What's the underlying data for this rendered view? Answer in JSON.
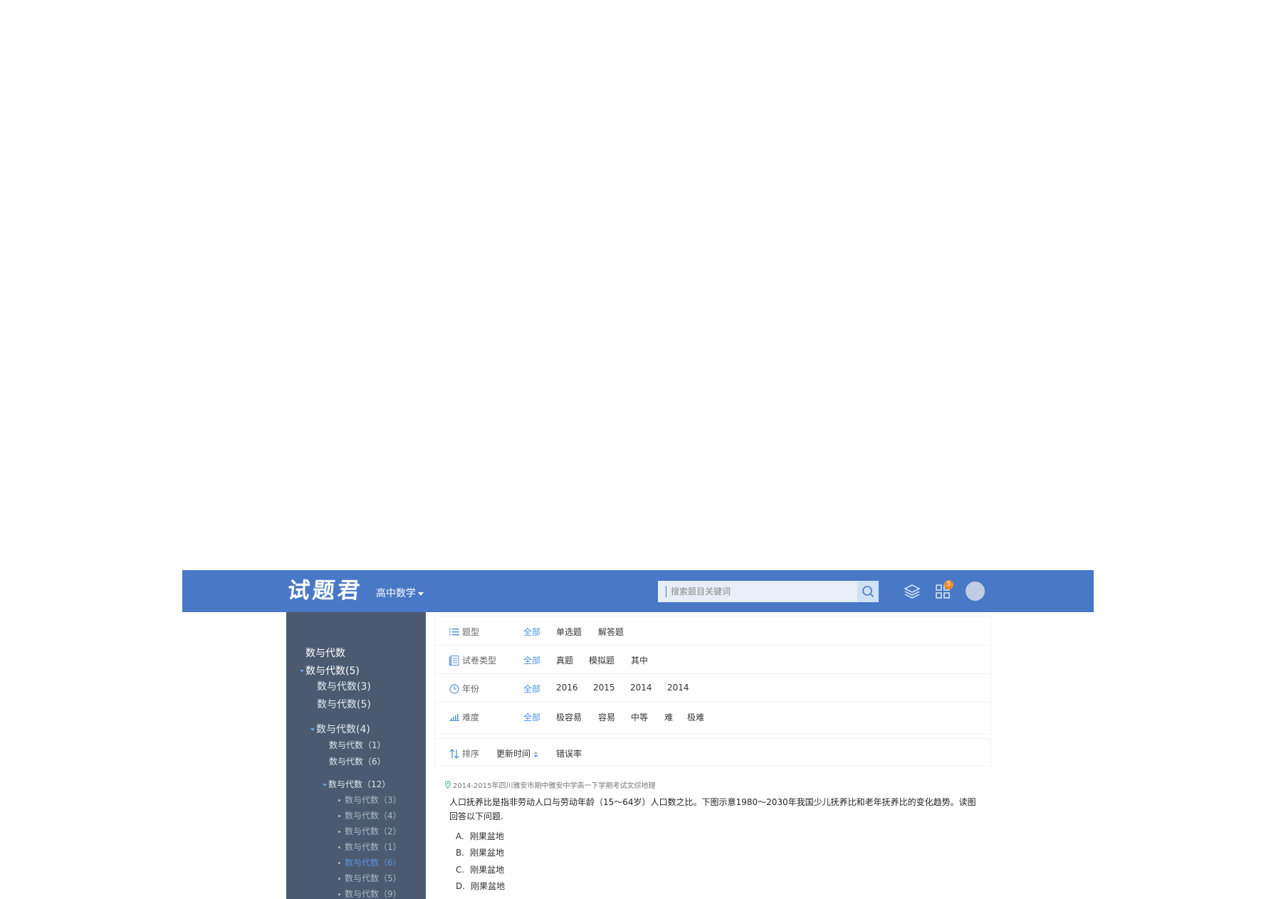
{
  "header": {
    "logo": "试题君",
    "subject": "高中数学",
    "search_placeholder": "搜索题目关键词",
    "badge_count": "5"
  },
  "sidebar": {
    "root": "数与代数",
    "items": [
      {
        "label": "数与代数(5)"
      },
      {
        "label": "数与代数(3)"
      },
      {
        "label": "数与代数(5)"
      },
      {
        "label": "数与代数(4)"
      },
      {
        "label": "数与代数（1）"
      },
      {
        "label": "数与代数（6）"
      },
      {
        "label": "数与代数（12）"
      },
      {
        "label": "数与代数（3）"
      },
      {
        "label": "数与代数（4）"
      },
      {
        "label": "数与代数（2）"
      },
      {
        "label": "数与代数（1）"
      },
      {
        "label": "数与代数（6）"
      },
      {
        "label": "数与代数（5）"
      },
      {
        "label": "数与代数（9）"
      }
    ]
  },
  "filters": {
    "type": {
      "label": "题型",
      "options": [
        "全部",
        "单选题",
        "解答题"
      ]
    },
    "paper": {
      "label": "试卷类型",
      "options": [
        "全部",
        "真题",
        "模拟题",
        "其中"
      ]
    },
    "year": {
      "label": "年份",
      "options": [
        "全部",
        "2016",
        "2015",
        "2014",
        "2014"
      ]
    },
    "difficulty": {
      "label": "难度",
      "options": [
        "全部",
        "极容易",
        "容易",
        "中等",
        "难",
        "极难"
      ]
    }
  },
  "sort": {
    "label": "排序",
    "options": [
      "更新时间",
      "错误率"
    ]
  },
  "question": {
    "source": "2014-2015年四川雅安市期中雅安中学高一下学期考试文综地理",
    "stem": "人口抚养比是指非劳动人口与劳动年龄（15～64岁）人口数之比。下图示意1980～2030年我国少儿抚养比和老年抚养比的变化趋势。读图回答以下问题.",
    "options": [
      {
        "letter": "A.",
        "text": "刚果盆地"
      },
      {
        "letter": "B.",
        "text": "刚果盆地"
      },
      {
        "letter": "C.",
        "text": "刚果盆地"
      },
      {
        "letter": "D.",
        "text": "刚果盆地"
      }
    ]
  },
  "colors": {
    "header_bg": "#4878c6",
    "sidebar_bg": "#4b5a70",
    "accent": "#4a90e2"
  }
}
